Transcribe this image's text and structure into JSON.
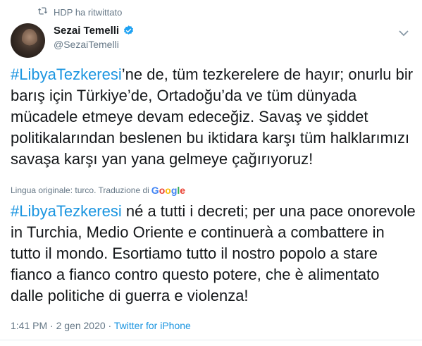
{
  "retweet": {
    "icon": "retweet-icon",
    "label": "HDP ha ritwittato"
  },
  "author": {
    "name": "Sezai Temelli",
    "handle": "@SezaiTemelli",
    "verified_icon": "verified-badge-icon"
  },
  "original": {
    "hashtag": "#LibyaTezkeresi",
    "text": "’ne de, tüm tezkerelere de hayır; onurlu bir barış için Türkiye’de, Ortadoğu’da ve tüm dünyada mücadele etmeye devam edeceğiz. Savaş ve şiddet politikalarından beslenen bu iktidara karşı tüm halklarımızı savaşa karşı yan yana gelmeye çağırıyoruz!"
  },
  "translation_note": {
    "label": "Lingua originale: turco. Traduzione di",
    "provider": "Google"
  },
  "translated": {
    "hashtag": "#LibyaTezkeresi",
    "text": " né a tutti i decreti; per una pace onorevole in Turchia, Medio Oriente e continuerà a combattere in tutto il mondo. Esortiamo tutto il nostro popolo a stare fianco a fianco contro questo potere, che è alimentato dalle politiche di guerra e violenza!"
  },
  "meta": {
    "time": "1:41 PM",
    "separator1": " · ",
    "date": "2 gen 2020",
    "separator2": " · ",
    "source": "Twitter for iPhone"
  },
  "colors": {
    "link": "#1b95e0",
    "secondary_text": "#657786",
    "verified": "#1da1f2"
  }
}
